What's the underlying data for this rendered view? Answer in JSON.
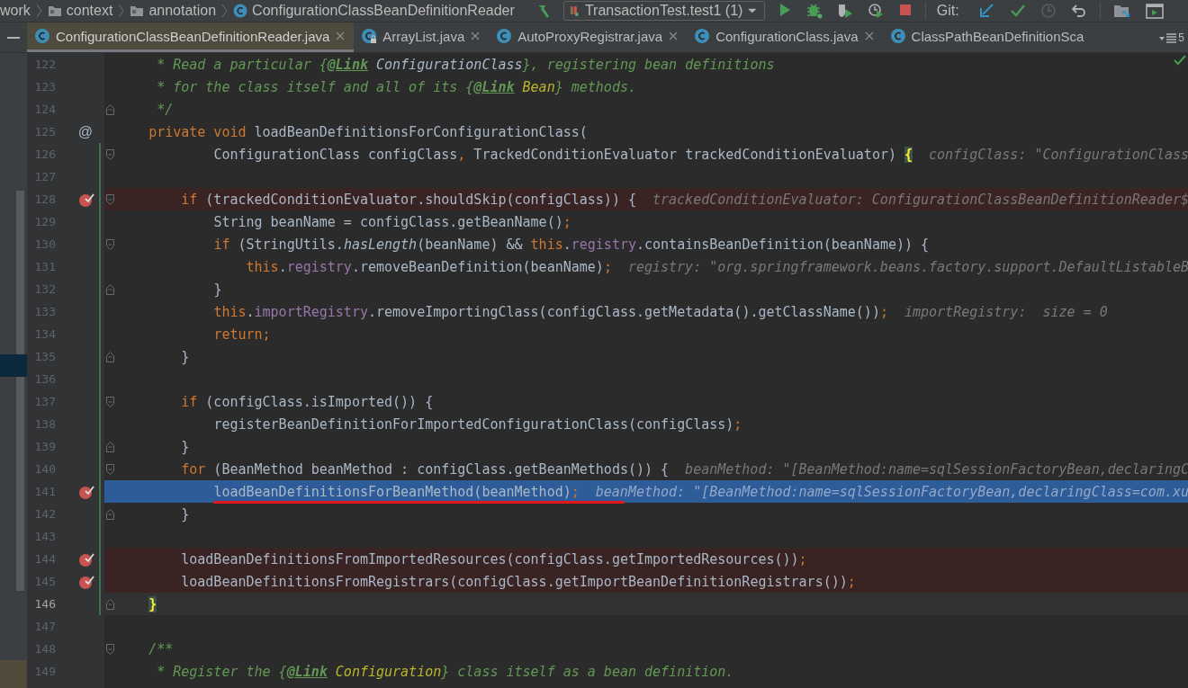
{
  "breadcrumbs": [
    {
      "kind": "plain",
      "text": "work"
    },
    {
      "kind": "folder",
      "text": "context"
    },
    {
      "kind": "folder",
      "text": "annotation"
    },
    {
      "kind": "class",
      "text": "ConfigurationClassBeanDefinitionReader"
    }
  ],
  "run_config": {
    "label": "TransactionTest.test1 (1)"
  },
  "toolbar": [
    {
      "kind": "run"
    },
    {
      "kind": "debug"
    },
    {
      "kind": "coverage"
    },
    {
      "kind": "profile"
    },
    {
      "kind": "stop"
    },
    {
      "kind": "git-label",
      "text": "Git:"
    },
    {
      "kind": "update"
    },
    {
      "kind": "commit"
    },
    {
      "kind": "history",
      "disabled": true
    },
    {
      "kind": "rollback"
    },
    {
      "kind": "structure"
    },
    {
      "kind": "terminal"
    }
  ],
  "tabs": [
    {
      "label": "ConfigurationClassBeanDefinitionReader.java",
      "selected": true,
      "locked": false,
      "closable": true
    },
    {
      "label": "ArrayList.java",
      "selected": false,
      "locked": true,
      "closable": true
    },
    {
      "label": "AutoProxyRegistrar.java",
      "selected": false,
      "locked": false,
      "closable": true
    },
    {
      "label": "ConfigurationClass.java",
      "selected": false,
      "locked": false,
      "closable": true
    },
    {
      "label": "ClassPathBeanDefinitionSca",
      "selected": false,
      "locked": false,
      "closable": false
    }
  ],
  "hidden_tabs": {
    "count": "5"
  },
  "lines": [
    {
      "number": "122",
      "tokens": [
        {
          "kind": "doc",
          "text": "     * Read a particular {"
        },
        {
          "kind": "doctag",
          "text": "@Link"
        },
        {
          "kind": "docref",
          "text": " ConfigurationClass"
        },
        {
          "kind": "doc",
          "text": "}, registering bean definitions"
        }
      ],
      "fold_start": false,
      "fold_end": false,
      "breakpoint": false,
      "changed": false,
      "execution": false,
      "current": false
    },
    {
      "number": "123",
      "tokens": [
        {
          "kind": "doc",
          "text": "     * for the class itself and all of its {"
        },
        {
          "kind": "doctag",
          "text": "@Link"
        },
        {
          "kind": "docannot",
          "text": " Bean"
        },
        {
          "kind": "doc",
          "text": "} methods."
        }
      ],
      "fold_start": false,
      "fold_end": false,
      "breakpoint": false,
      "changed": false,
      "execution": false,
      "current": false
    },
    {
      "number": "124",
      "tokens": [
        {
          "kind": "doc",
          "text": "     */"
        }
      ],
      "fold_start": false,
      "fold_end": true,
      "breakpoint": false,
      "changed": false,
      "execution": false,
      "current": false
    },
    {
      "number": "125",
      "gutter_mark": "@",
      "tokens": [
        {
          "kind": "keyword",
          "text": "    private void "
        },
        {
          "kind": "plain",
          "text": "loadBeanDefinitionsForConfigurationClass("
        }
      ],
      "fold_start": false,
      "fold_end": false,
      "breakpoint": false,
      "changed": false,
      "execution": false,
      "current": false
    },
    {
      "number": "126",
      "tokens": [
        {
          "kind": "plain",
          "text": "            ConfigurationClass configClass"
        },
        {
          "kind": "keyword",
          "text": ","
        },
        {
          "kind": "plain",
          "text": " TrackedConditionEvaluator trackedConditionEvaluator) "
        },
        {
          "kind": "brace",
          "text": "{"
        }
      ],
      "hint": "configClass: \"ConfigurationClass",
      "fold_start": true,
      "fold_end": false,
      "breakpoint": false,
      "changed": true,
      "execution": false,
      "current": false
    },
    {
      "number": "127",
      "fold_start": false,
      "fold_end": false,
      "breakpoint": false,
      "changed": true,
      "execution": false,
      "current": false
    },
    {
      "number": "128",
      "tokens": [
        {
          "kind": "keyword",
          "text": "        if"
        },
        {
          "kind": "plain",
          "text": " (trackedConditionEvaluator.shouldSkip(configClass)) {"
        }
      ],
      "hint": "trackedConditionEvaluator: ConfigurationClassBeanDefinitionReader$",
      "fold_start": true,
      "fold_end": false,
      "breakpoint": true,
      "changed": true,
      "execution": false,
      "current": false
    },
    {
      "number": "129",
      "tokens": [
        {
          "kind": "plain",
          "text": "            String beanName = configClass.getBeanName()"
        },
        {
          "kind": "keyword",
          "text": ";"
        }
      ],
      "fold_start": false,
      "fold_end": false,
      "breakpoint": false,
      "changed": true,
      "execution": false,
      "current": false
    },
    {
      "number": "130",
      "tokens": [
        {
          "kind": "keyword",
          "text": "            if"
        },
        {
          "kind": "plain",
          "text": " (StringUtils."
        },
        {
          "kind": "static",
          "text": "hasLength"
        },
        {
          "kind": "plain",
          "text": "(beanName) && "
        },
        {
          "kind": "keyword",
          "text": "this"
        },
        {
          "kind": "plain",
          "text": "."
        },
        {
          "kind": "field",
          "text": "registry"
        },
        {
          "kind": "plain",
          "text": ".containsBeanDefinition(beanName)) {"
        }
      ],
      "fold_start": true,
      "fold_end": false,
      "breakpoint": false,
      "changed": true,
      "execution": false,
      "current": false
    },
    {
      "number": "131",
      "tokens": [
        {
          "kind": "keyword",
          "text": "                this"
        },
        {
          "kind": "plain",
          "text": "."
        },
        {
          "kind": "field",
          "text": "registry"
        },
        {
          "kind": "plain",
          "text": ".removeBeanDefinition(beanName)"
        },
        {
          "kind": "keyword",
          "text": ";"
        }
      ],
      "hint": "registry: \"org.springframework.beans.factory.support.DefaultListableB",
      "fold_start": false,
      "fold_end": false,
      "breakpoint": false,
      "changed": true,
      "execution": false,
      "current": false
    },
    {
      "number": "132",
      "tokens": [
        {
          "kind": "plain",
          "text": "            }"
        }
      ],
      "fold_start": false,
      "fold_end": true,
      "breakpoint": false,
      "changed": true,
      "execution": false,
      "current": false
    },
    {
      "number": "133",
      "tokens": [
        {
          "kind": "keyword",
          "text": "            this"
        },
        {
          "kind": "plain",
          "text": "."
        },
        {
          "kind": "field",
          "text": "importRegistry"
        },
        {
          "kind": "plain",
          "text": ".removeImportingClass(configClass.getMetadata().getClassName())"
        },
        {
          "kind": "keyword",
          "text": ";"
        }
      ],
      "hint": "importRegistry:  size = 0",
      "fold_start": false,
      "fold_end": false,
      "breakpoint": false,
      "changed": true,
      "execution": false,
      "current": false
    },
    {
      "number": "134",
      "tokens": [
        {
          "kind": "keyword",
          "text": "            return;"
        }
      ],
      "fold_start": false,
      "fold_end": false,
      "breakpoint": false,
      "changed": true,
      "execution": false,
      "current": false
    },
    {
      "number": "135",
      "tokens": [
        {
          "kind": "plain",
          "text": "        }"
        }
      ],
      "fold_start": false,
      "fold_end": true,
      "breakpoint": false,
      "changed": true,
      "execution": false,
      "current": false
    },
    {
      "number": "136",
      "fold_start": false,
      "fold_end": false,
      "breakpoint": false,
      "changed": true,
      "execution": false,
      "current": false
    },
    {
      "number": "137",
      "tokens": [
        {
          "kind": "keyword",
          "text": "        if"
        },
        {
          "kind": "plain",
          "text": " (configClass.isImported()) {"
        }
      ],
      "fold_start": true,
      "fold_end": false,
      "breakpoint": false,
      "changed": true,
      "execution": false,
      "current": false
    },
    {
      "number": "138",
      "tokens": [
        {
          "kind": "plain",
          "text": "            registerBeanDefinitionForImportedConfigurationClass(configClass)"
        },
        {
          "kind": "keyword",
          "text": ";"
        }
      ],
      "fold_start": false,
      "fold_end": false,
      "breakpoint": false,
      "changed": true,
      "execution": false,
      "current": false
    },
    {
      "number": "139",
      "tokens": [
        {
          "kind": "plain",
          "text": "        }"
        }
      ],
      "fold_start": false,
      "fold_end": true,
      "breakpoint": false,
      "changed": true,
      "execution": false,
      "current": false
    },
    {
      "number": "140",
      "tokens": [
        {
          "kind": "keyword",
          "text": "        for"
        },
        {
          "kind": "plain",
          "text": " (BeanMethod beanMethod : configClass.getBeanMethods()) {"
        }
      ],
      "hint": "beanMethod: \"[BeanMethod:name=sqlSessionFactoryBean,declaringC",
      "fold_start": true,
      "fold_end": false,
      "breakpoint": false,
      "changed": true,
      "execution": false,
      "current": false
    },
    {
      "number": "141",
      "tokens": [
        {
          "kind": "plain",
          "text": "            loadBeanDefinitionsForBeanMethod(beanMethod)"
        },
        {
          "kind": "keyword",
          "text": ";"
        }
      ],
      "hint": "beanMethod: \"[BeanMethod:name=sqlSessionFactoryBean,declaringClass=com.xu",
      "fold_start": false,
      "fold_end": false,
      "breakpoint": true,
      "changed": true,
      "execution": true,
      "current": false,
      "underlined": true
    },
    {
      "number": "142",
      "tokens": [
        {
          "kind": "plain",
          "text": "        }"
        }
      ],
      "fold_start": false,
      "fold_end": true,
      "breakpoint": false,
      "changed": true,
      "execution": false,
      "current": false
    },
    {
      "number": "143",
      "fold_start": false,
      "fold_end": false,
      "breakpoint": false,
      "changed": true,
      "execution": false,
      "current": false
    },
    {
      "number": "144",
      "tokens": [
        {
          "kind": "plain",
          "text": "        loadBeanDefinitionsFromImportedResources(configClass.getImportedResources())"
        },
        {
          "kind": "keyword",
          "text": ";"
        }
      ],
      "fold_start": false,
      "fold_end": false,
      "breakpoint": true,
      "changed": true,
      "execution": false,
      "current": false
    },
    {
      "number": "145",
      "tokens": [
        {
          "kind": "plain",
          "text": "        loadBeanDefinitionsFromRegistrars(configClass.getImportBeanDefinitionRegistrars())"
        },
        {
          "kind": "keyword",
          "text": ";"
        }
      ],
      "fold_start": false,
      "fold_end": false,
      "breakpoint": true,
      "changed": true,
      "execution": false,
      "current": false
    },
    {
      "number": "146",
      "tokens": [
        {
          "kind": "brace",
          "text": "    }"
        }
      ],
      "fold_start": false,
      "fold_end": true,
      "breakpoint": false,
      "changed": true,
      "execution": false,
      "current": true
    },
    {
      "number": "147",
      "fold_start": false,
      "fold_end": false,
      "breakpoint": false,
      "changed": false,
      "execution": false,
      "current": false
    },
    {
      "number": "148",
      "tokens": [
        {
          "kind": "doc",
          "text": "    /**"
        }
      ],
      "fold_start": true,
      "fold_end": false,
      "breakpoint": false,
      "changed": false,
      "execution": false,
      "current": false
    },
    {
      "number": "149",
      "tokens": [
        {
          "kind": "doc",
          "text": "     * Register the {"
        },
        {
          "kind": "doctag",
          "text": "@Link"
        },
        {
          "kind": "docannot",
          "text": " Configuration"
        },
        {
          "kind": "doc",
          "text": "} class itself as a bean definition."
        }
      ],
      "fold_start": false,
      "fold_end": false,
      "breakpoint": false,
      "changed": false,
      "execution": false,
      "current": false
    }
  ]
}
